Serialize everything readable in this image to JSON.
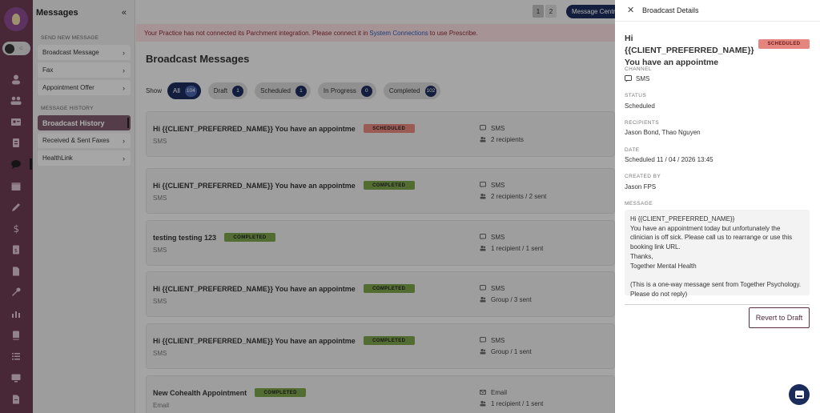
{
  "sidebar": {
    "header": "Messages",
    "collapse_icon": "double-chevron-left-icon",
    "send_section_title": "SEND NEW MESSAGE",
    "send_items": [
      {
        "label": "Broadcast Message"
      },
      {
        "label": "Fax"
      },
      {
        "label": "Appointment Offer"
      }
    ],
    "history_section_title": "MESSAGE HISTORY",
    "history_items": [
      {
        "label": "Broadcast History",
        "active": true
      },
      {
        "label": "Received & Sent Faxes"
      },
      {
        "label": "HealthLink"
      }
    ]
  },
  "rail": {
    "icons": [
      "users-icon",
      "group-icon",
      "id-card-icon",
      "clipboard-icon",
      "chat-icon",
      "calendar-icon",
      "pen-icon",
      "dollar-icon",
      "invoice-icon",
      "document-icon",
      "wrench-icon",
      "chart-icon",
      "book-icon",
      "list-icon",
      "monitor-icon",
      "file-icon"
    ],
    "active": "chat-icon"
  },
  "topbar": {
    "pages": [
      "1",
      "2"
    ],
    "current_page": "1",
    "message_centre_label": "Message Centre"
  },
  "alert": {
    "text_before": "Your Practice has not connected its Parchment integration. Please connect it in",
    "link": "System Connections",
    "text_after": "to use Prescribe."
  },
  "main": {
    "title": "Broadcast Messages",
    "show_label": "Show",
    "filters": [
      {
        "label": "All",
        "count": "104",
        "active": true
      },
      {
        "label": "Draft",
        "count": "1"
      },
      {
        "label": "Scheduled",
        "count": "1"
      },
      {
        "label": "In Progress",
        "count": "0"
      },
      {
        "label": "Completed",
        "count": "102"
      }
    ],
    "messages": [
      {
        "title": "Hi {{CLIENT_PREFERRED_NAME}} You have an appointme",
        "status": "SCHEDULED",
        "channel": "SMS",
        "channel_meta": "SMS",
        "recipients": "2 recipients"
      },
      {
        "title": "Hi {{CLIENT_PREFERRED_NAME}} You have an appointme",
        "status": "COMPLETED",
        "channel": "SMS",
        "channel_meta": "SMS",
        "recipients": "2 recipients / 2 sent"
      },
      {
        "title": "testing testing 123",
        "status": "COMPLETED",
        "channel": "SMS",
        "channel_meta": "SMS",
        "recipients": "1 recipient / 1 sent"
      },
      {
        "title": "Hi {{CLIENT_PREFERRED_NAME}} You have an appointme",
        "status": "COMPLETED",
        "channel": "SMS",
        "channel_meta": "SMS",
        "recipients": "Group / 3 sent"
      },
      {
        "title": "Hi {{CLIENT_PREFERRED_NAME}} You have an appointme",
        "status": "COMPLETED",
        "channel": "SMS",
        "channel_meta": "SMS",
        "recipients": "Group / 1 sent"
      },
      {
        "title": "New Cohealth Appointment",
        "status": "COMPLETED",
        "channel": "Email",
        "channel_meta": "Email",
        "recipients": "1 recipient / 1 sent"
      }
    ]
  },
  "details": {
    "panel_title": "Broadcast Details",
    "title_line1": "Hi {{CLIENT_PREFERRED_NAME}}",
    "title_line2": "You have an appointme",
    "status_badge": "SCHEDULED",
    "channel_label": "CHANNEL",
    "channel_value": "SMS",
    "status_label": "STATUS",
    "status_value": "Scheduled",
    "recipients_label": "RECIPIENTS",
    "recipients_value": "Jason Bond, Thao Nguyen",
    "date_label": "DATE",
    "date_value": "Scheduled 11 / 04 / 2026 13:45",
    "created_by_label": "CREATED BY",
    "created_by_value": "Jason FPS",
    "message_label": "MESSAGE",
    "message_lines": [
      "Hi {{CLIENT_PREFERRED_NAME}}",
      "You have an appointment today but unfortunately the clinician is off sick. Please call us to rearrange or use this booking link URL.",
      "Thanks,",
      "Together Mental Health",
      "",
      "(This is a one-way message sent from Together Psychology. Please do not reply)"
    ],
    "revert_button": "Revert to Draft"
  },
  "colors": {
    "brand_navy": "#1c2c5a",
    "rail": "#6b3a52",
    "completed": "#79a04a",
    "scheduled": "#e4867e"
  }
}
